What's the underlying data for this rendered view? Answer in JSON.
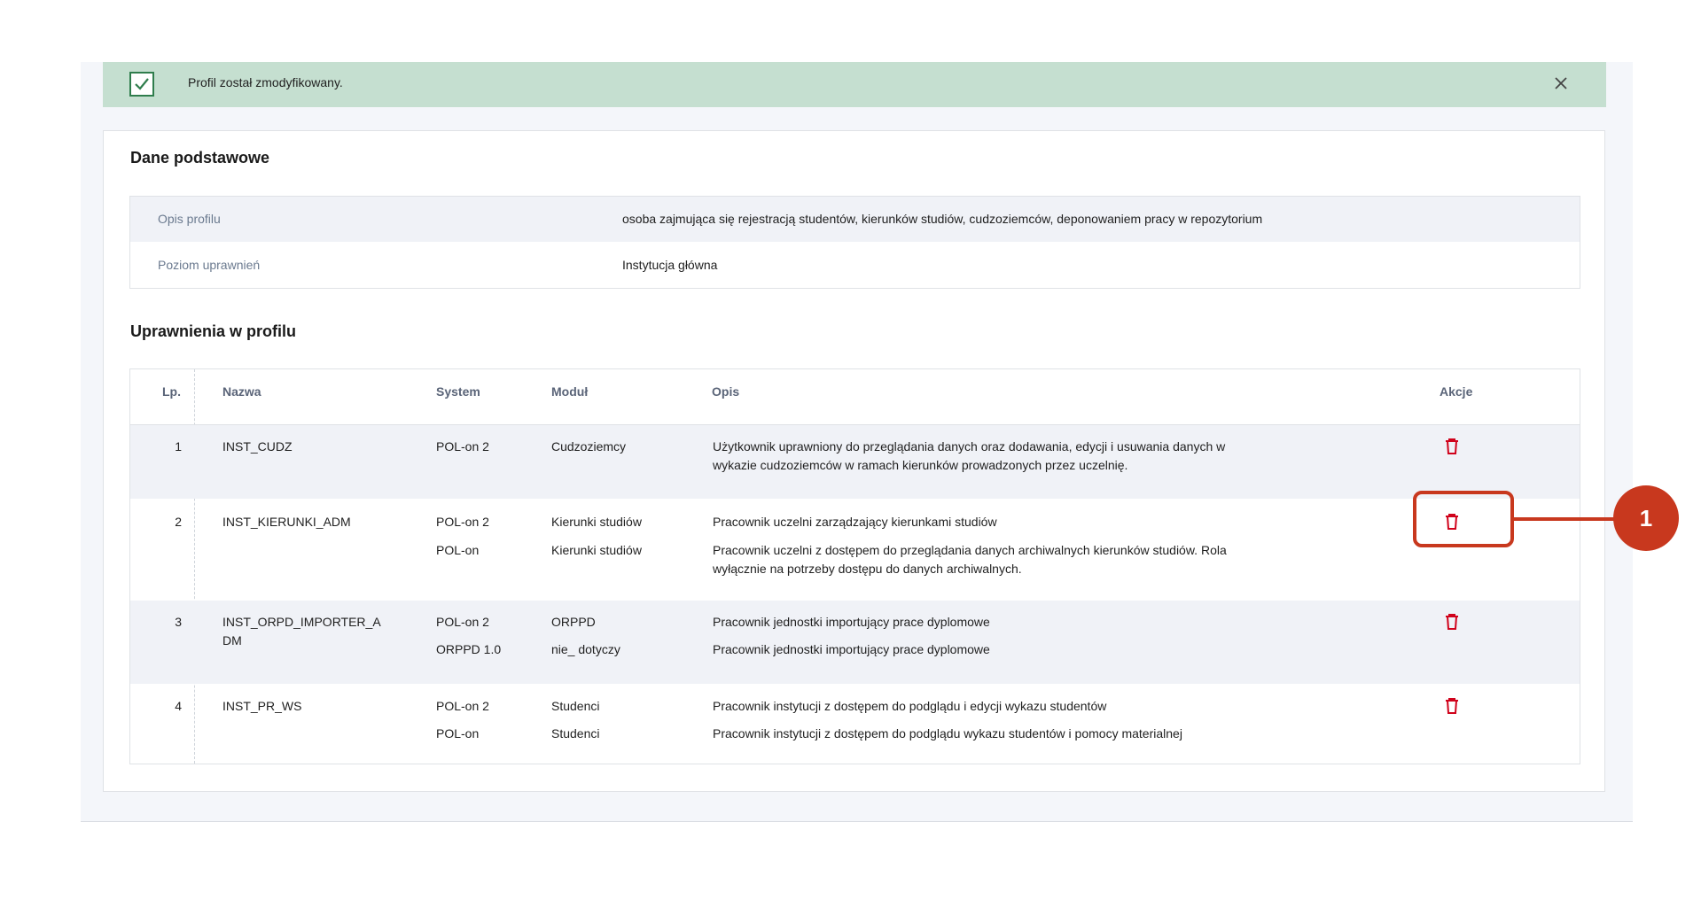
{
  "alert": {
    "message": "Profil został zmodyfikowany.",
    "icon": "check-icon",
    "close_icon": "close-icon",
    "color": "#c5dfd0"
  },
  "basic": {
    "title": "Dane podstawowe",
    "rows": [
      {
        "label": "Opis profilu",
        "value": "osoba zajmująca się rejestracją studentów, kierunków studiów, cudzoziemców, deponowaniem pracy w repozytorium"
      },
      {
        "label": "Poziom uprawnień",
        "value": "Instytucja główna"
      }
    ]
  },
  "permissions": {
    "title": "Uprawnienia w profilu",
    "headers": {
      "lp": "Lp.",
      "name": "Nazwa",
      "system": "System",
      "module": "Moduł",
      "desc": "Opis",
      "actions": "Akcje"
    },
    "rows": [
      {
        "lp": "1",
        "name": "INST_CUDZ",
        "entries": [
          {
            "system": "POL-on 2",
            "module": "Cudzoziemcy",
            "desc": "Użytkownik uprawniony do przeglądania danych oraz dodawania, edycji i usuwania danych w wykazie cudzoziemców w ramach kierunków prowadzonych przez uczelnię."
          }
        ]
      },
      {
        "lp": "2",
        "name": "INST_KIERUNKI_ADM",
        "entries": [
          {
            "system": "POL-on 2",
            "module": "Kierunki studiów",
            "desc": "Pracownik uczelni zarządzający kierunkami studiów"
          },
          {
            "system": "POL-on",
            "module": "Kierunki studiów",
            "desc": "Pracownik uczelni z dostępem do przeglądania danych archiwalnych kierunków studiów. Rola wyłącznie na potrzeby dostępu do danych archiwalnych."
          }
        ]
      },
      {
        "lp": "3",
        "name": "INST_ORPD_IMPORTER_ADM",
        "entries": [
          {
            "system": "POL-on 2",
            "module": "ORPPD",
            "desc": "Pracownik jednostki importujący prace dyplomowe"
          },
          {
            "system": "ORPPD 1.0",
            "module": "nie_ dotyczy",
            "desc": "Pracownik jednostki importujący prace dyplomowe"
          }
        ]
      },
      {
        "lp": "4",
        "name": "INST_PR_WS",
        "entries": [
          {
            "system": "POL-on 2",
            "module": "Studenci",
            "desc": "Pracownik instytucji z dostępem do podglądu i edycji wykazu studentów"
          },
          {
            "system": "POL-on",
            "module": "Studenci",
            "desc": "Pracownik instytucji z dostępem do podglądu wykazu studentów i pomocy materialnej"
          }
        ]
      }
    ],
    "action_icon": "trash-icon",
    "action_color": "#d0021b"
  },
  "callout": {
    "label": "1",
    "color": "#c8381e"
  }
}
